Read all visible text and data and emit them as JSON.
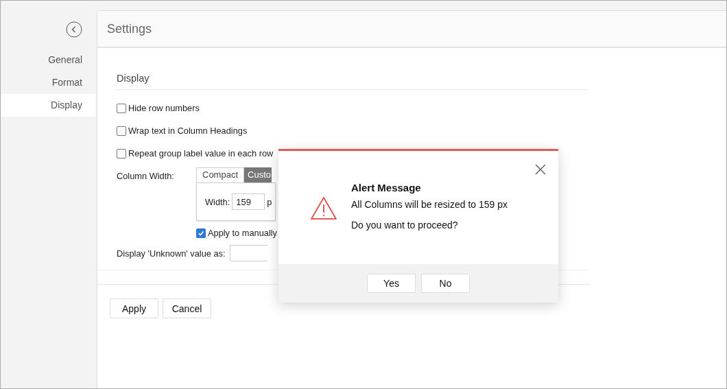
{
  "sidebar": {
    "items": [
      {
        "label": "General",
        "selected": false
      },
      {
        "label": "Format",
        "selected": false
      },
      {
        "label": "Display",
        "selected": true
      }
    ]
  },
  "header": {
    "title": "Settings"
  },
  "section": {
    "title": "Display"
  },
  "options": [
    {
      "label": "Hide row numbers",
      "checked": false
    },
    {
      "label": "Wrap text in Column Headings",
      "checked": false
    },
    {
      "label": "Repeat group label value in each row",
      "checked": false
    }
  ],
  "column_width": {
    "label": "Column Width:",
    "tabs": [
      {
        "label": "Compact",
        "selected": false
      },
      {
        "label": "Custo",
        "selected": true
      }
    ],
    "width_label": "Width:",
    "width_value": "159",
    "unit": "p",
    "apply_manual": {
      "label": "Apply to manually",
      "checked": true
    }
  },
  "unknown": {
    "label": "Display 'Unknown' value as:"
  },
  "buttons": [
    "Apply",
    "Cancel"
  ],
  "dialog": {
    "title": "Alert Message",
    "message": "All Columns will be resized to 159 px",
    "question": "Do you want to proceed?",
    "buttons": [
      "Yes",
      "No"
    ]
  }
}
